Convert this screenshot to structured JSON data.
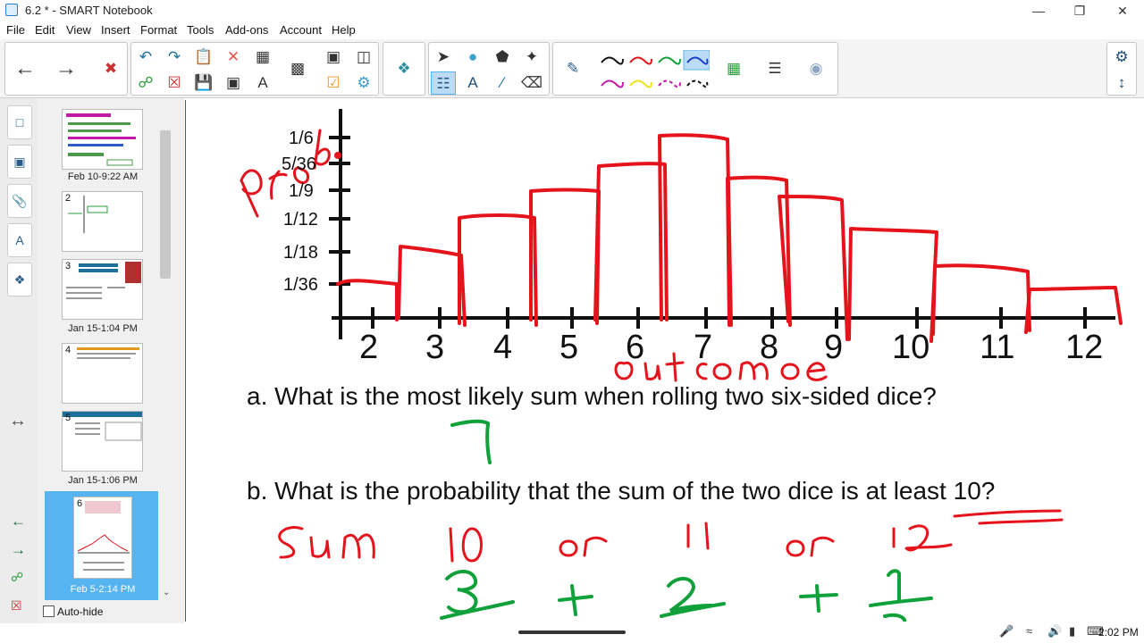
{
  "window": {
    "title": "6.2 * - SMART Notebook",
    "minimize": "—",
    "maximize": "❐",
    "close": "✕"
  },
  "menu": [
    "File",
    "Edit",
    "View",
    "Insert",
    "Format",
    "Tools",
    "Add-ons",
    "Account",
    "Help"
  ],
  "sidebar": {
    "pages": [
      {
        "label": "Feb 10-9:22 AM",
        "num": ""
      },
      {
        "label": "",
        "num": "2"
      },
      {
        "label": "Jan 15-1:04 PM",
        "num": "3"
      },
      {
        "label": "",
        "num": "4"
      },
      {
        "label": "Jan 15-1:06 PM",
        "num": "5"
      },
      {
        "label": "Feb 5-2:14 PM",
        "num": "6"
      }
    ],
    "autohide_label": "Auto-hide"
  },
  "graph": {
    "y_ticks": [
      "1/6",
      "5/36",
      "1/9",
      "1/12",
      "1/18",
      "1/36"
    ],
    "x_ticks": [
      "2",
      "3",
      "4",
      "5",
      "6",
      "7",
      "8",
      "9",
      "10",
      "11",
      "12"
    ]
  },
  "questions": {
    "a": "a.  What is the most likely sum when rolling two six-sided dice?",
    "b": "b.  What is the probability that the sum of the two dice is at least 10?"
  },
  "taskbar": {
    "time": "2:02 PM"
  },
  "colors": {
    "ink_red": "#e5141c",
    "ink_green": "#11a13a",
    "accent": "#56b4f0"
  }
}
